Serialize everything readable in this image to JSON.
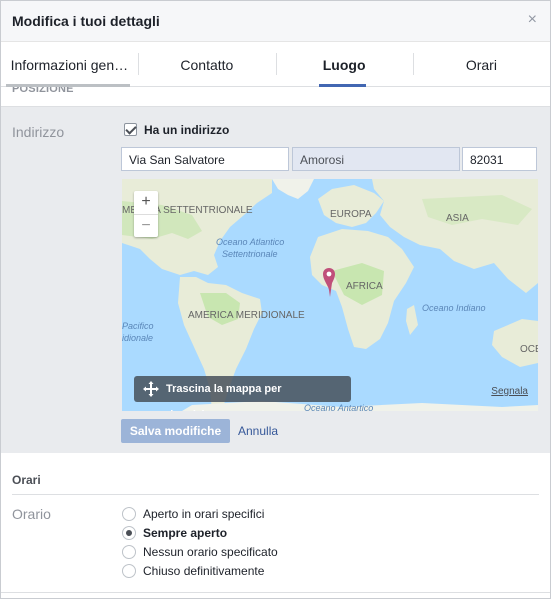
{
  "dialog": {
    "title": "Modifica i tuoi dettagli",
    "close_glyph": "×"
  },
  "tabs": [
    {
      "label": "Informazioni generali",
      "active": false
    },
    {
      "label": "Contatto",
      "active": false
    },
    {
      "label": "Luogo",
      "active": true
    },
    {
      "label": "Orari",
      "active": false
    }
  ],
  "position_section": {
    "heading": "POSIZIONE"
  },
  "address": {
    "label": "Indirizzo",
    "has_address_checkbox": {
      "label": "Ha un indirizzo",
      "checked": true
    },
    "street": "Via San Salvatore",
    "city": "Amorosi",
    "zip": "82031"
  },
  "map": {
    "zoom_in": "+",
    "zoom_out": "−",
    "labels": {
      "north_america": "MERICA SETTENTRIONALE",
      "europe": "EUROPA",
      "asia": "ASIA",
      "africa": "AFRICA",
      "south_america": "AMERICA MERIDIONALE",
      "atlantic": "Oceano Atlantico\nSettentrionale",
      "pacific": "Pacifico\nidionale",
      "indian": "Oceano Indiano",
      "antarctic": "Oceano Antartico",
      "oceania_cut": "OCE"
    },
    "drag_hint": "Trascina la mappa per riposizionare",
    "report_link": "Segnala",
    "colors": {
      "water": "#aadaff",
      "land": "#e8ecd8",
      "green": "#c8e6b0",
      "pin": "#c0507a"
    }
  },
  "actions": {
    "save": "Salva modifiche",
    "cancel": "Annulla"
  },
  "hours_section": {
    "heading": "Orari",
    "label": "Orario",
    "options": [
      {
        "label": "Aperto in orari specifici",
        "selected": false
      },
      {
        "label": "Sempre aperto",
        "selected": true
      },
      {
        "label": "Nessun orario specificato",
        "selected": false
      },
      {
        "label": "Chiuso definitivamente",
        "selected": false
      }
    ]
  }
}
